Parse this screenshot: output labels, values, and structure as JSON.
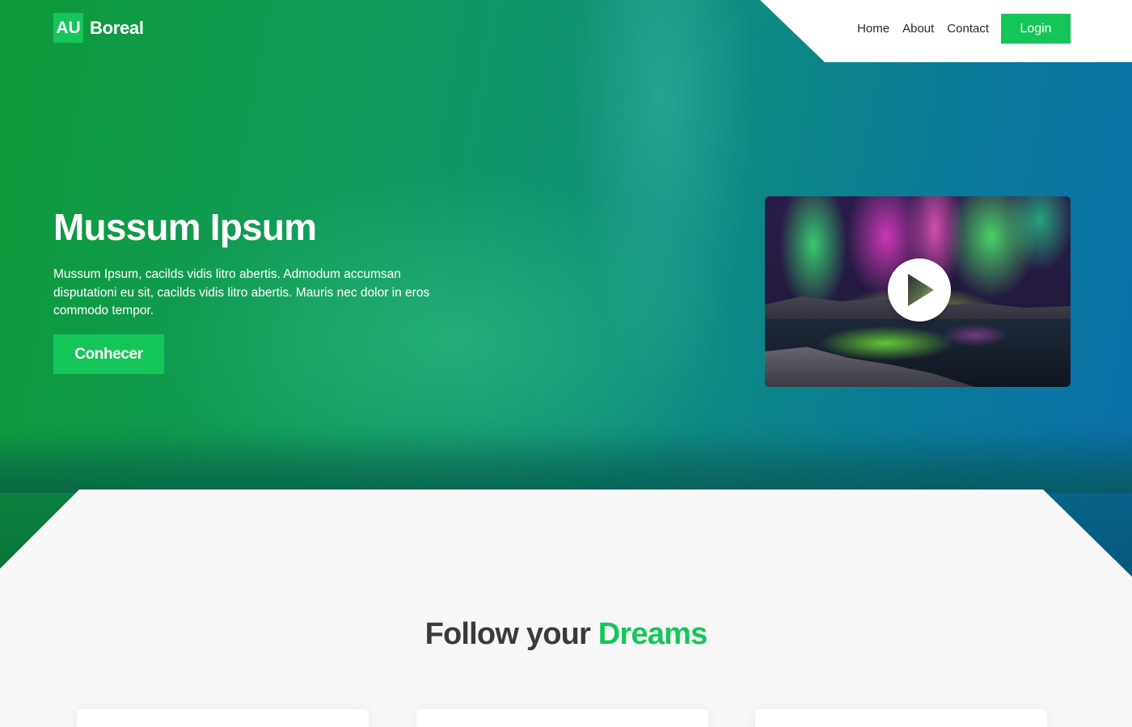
{
  "brand": {
    "badge": "AU",
    "name": "Boreal"
  },
  "nav": {
    "links": [
      "Home",
      "About",
      "Contact"
    ],
    "login_label": "Login"
  },
  "hero": {
    "title": "Mussum Ipsum",
    "description": "Mussum Ipsum, cacilds vidis litro abertis. Admodum accumsan disputationi eu sit, cacilds vidis litro abertis. Mauris nec dolor in eros commodo tempor.",
    "cta_label": "Conhecer"
  },
  "video": {
    "icon": "play-icon"
  },
  "section": {
    "title_prefix": "Follow your",
    "title_accent": "Dreams"
  },
  "colors": {
    "accent": "#14c65a",
    "text_dark": "#3a3a3a",
    "nav_text": "#2a2a2a"
  }
}
